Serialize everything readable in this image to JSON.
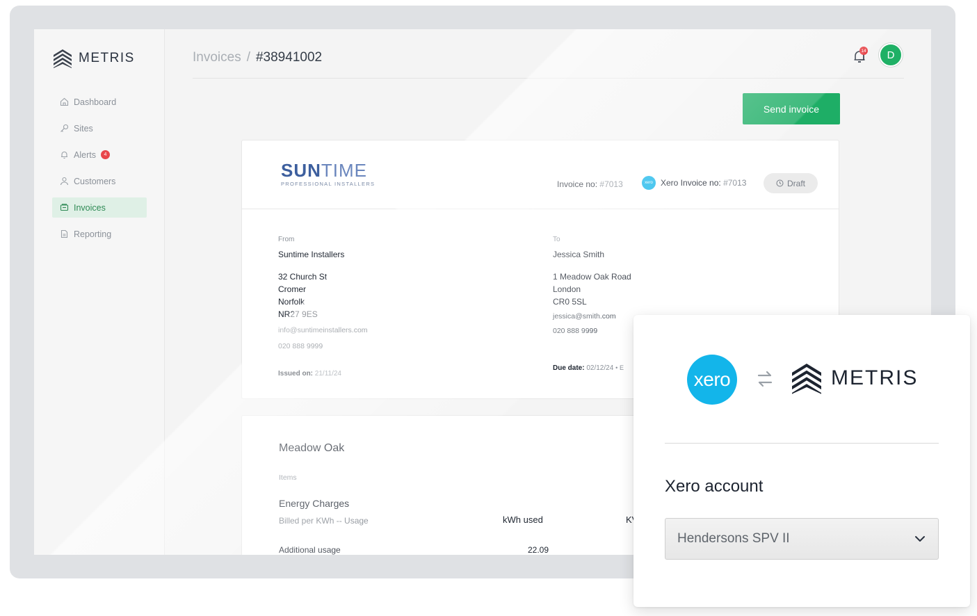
{
  "app": {
    "brand": "METRIS"
  },
  "sidebar": {
    "items": [
      {
        "label": "Dashboard",
        "icon": "home-icon"
      },
      {
        "label": "Sites",
        "icon": "key-icon"
      },
      {
        "label": "Alerts",
        "icon": "bell-icon",
        "badge": "4"
      },
      {
        "label": "Customers",
        "icon": "users-icon"
      },
      {
        "label": "Invoices",
        "icon": "invoice-icon",
        "active": true
      },
      {
        "label": "Reporting",
        "icon": "document-icon"
      }
    ]
  },
  "header": {
    "breadcrumb_parent": "Invoices",
    "breadcrumb_sep": "/",
    "breadcrumb_current": "#38941002",
    "notification_count": "14",
    "avatar_initial": "D"
  },
  "actions": {
    "send_invoice": "Send invoice"
  },
  "invoice": {
    "logo_main_bold": "SUN",
    "logo_main_light": "TIME",
    "logo_sub": "PROFESSIONAL INSTALLERS",
    "invoice_no_label": "Invoice no:",
    "invoice_no": "#7013",
    "xero_invoice_no_label": "Xero Invoice no:",
    "xero_invoice_no": "#7013",
    "xero_mini": "xero",
    "status": "Draft",
    "from": {
      "label": "From",
      "name": "Suntime Installers",
      "address": [
        "32 Church St",
        "Cromer",
        "Norfolk",
        "NR27 9ES"
      ],
      "email": "info@suntimeinstallers.com",
      "phone": "020 888 9999",
      "issued_label": "Issued on:",
      "issued_value": "21/11/24"
    },
    "to": {
      "label": "To",
      "name": "Jessica Smith",
      "address": [
        "1 Meadow Oak Road",
        "London",
        "CR0 5SL"
      ],
      "email": "jessica@smith.com",
      "phone": "020 888 9999",
      "due_label": "Due date:",
      "due_value": "02/12/24",
      "status_glyph": "E"
    }
  },
  "site_card": {
    "title": "Meadow Oak",
    "items_label": "Items",
    "item_title": "Energy Charges",
    "item_desc": "Billed per KWh -- Usage",
    "col_kwh": "kWh used",
    "col_kw_partial": "KV",
    "row_label": "Additional usage",
    "row_value": "22.09"
  },
  "overlay": {
    "xero_logo_text": "xero",
    "brand": "METRIS",
    "title": "Xero account",
    "selected_account": "Hendersons SPV II"
  },
  "colors": {
    "accent_green": "#1eae66",
    "xero_blue": "#13b5ea",
    "alert_red": "#e8454a"
  }
}
